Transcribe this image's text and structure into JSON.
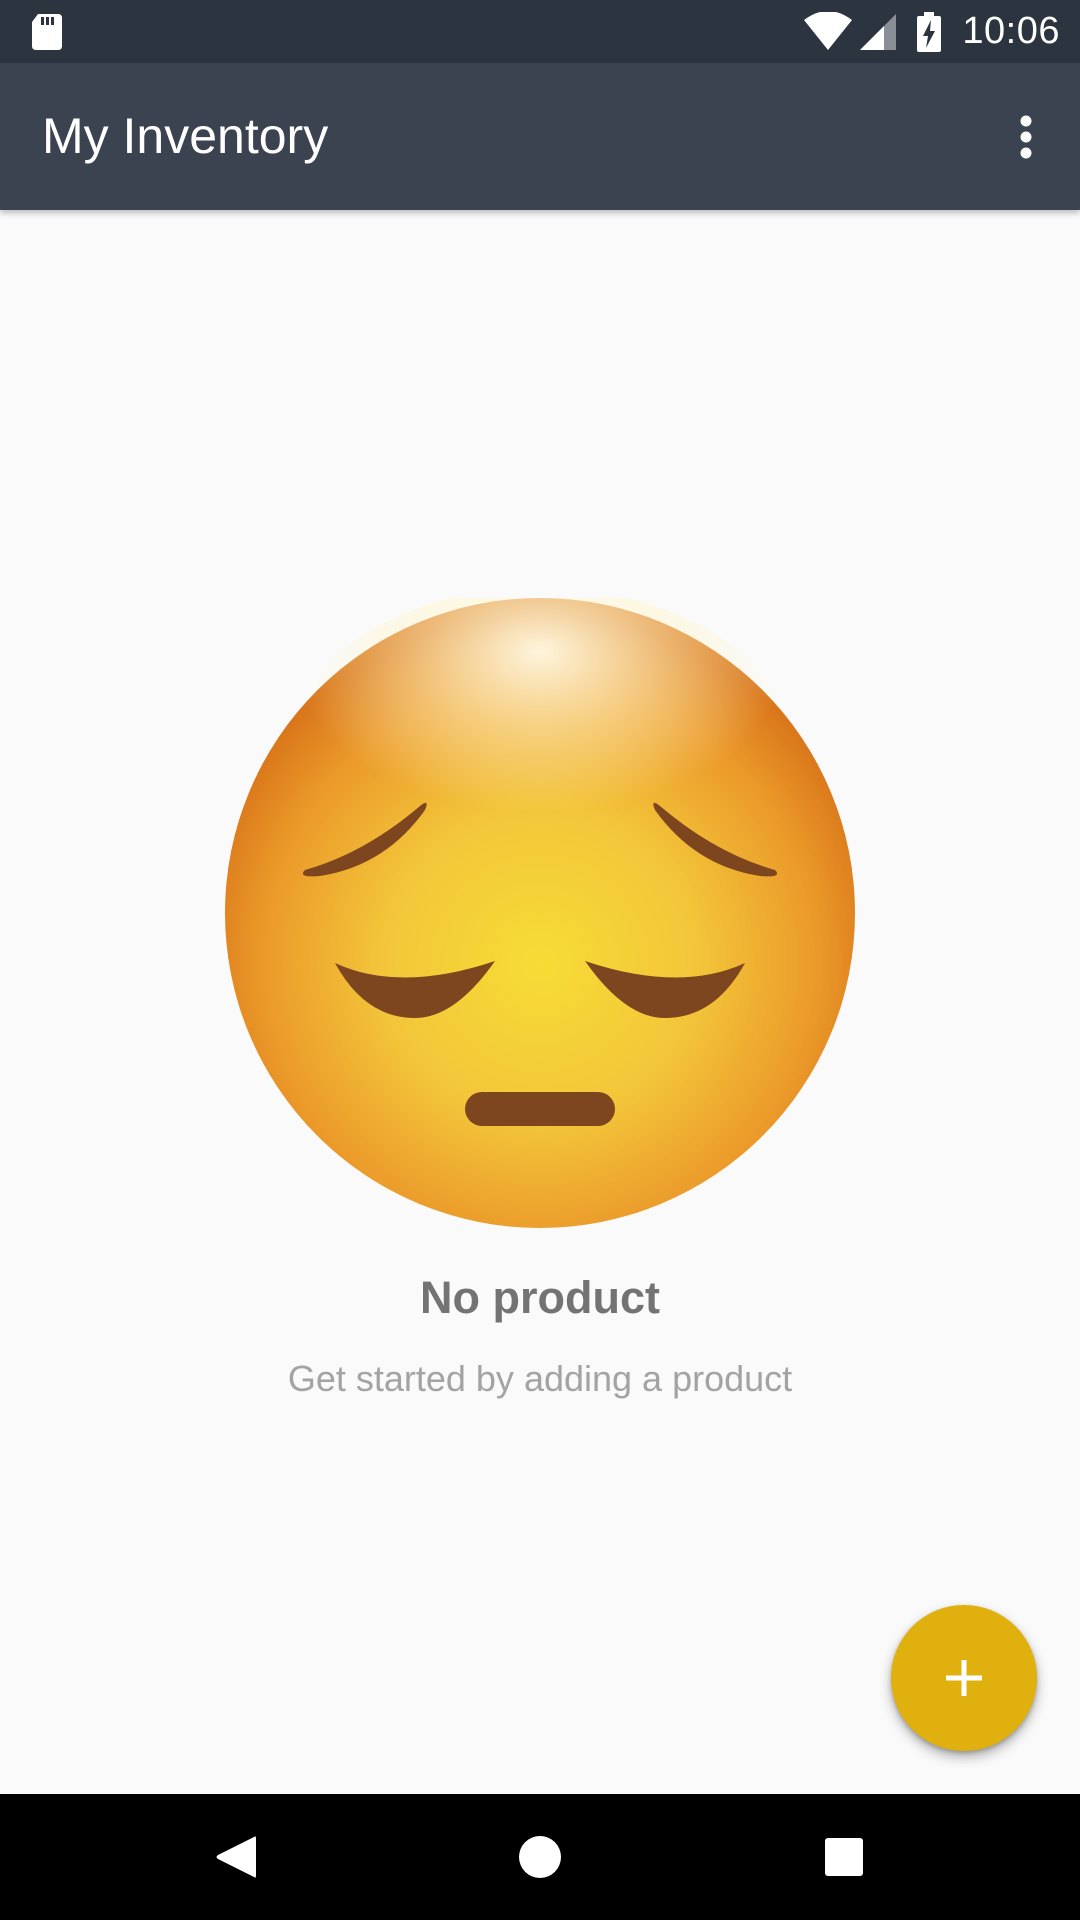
{
  "status_bar": {
    "time": "10:06",
    "icons": [
      "sd-card-icon",
      "wifi-icon",
      "cell-signal-icon",
      "battery-charging-icon"
    ]
  },
  "app_bar": {
    "title": "My Inventory",
    "menu_icon": "more-vert-icon"
  },
  "empty_state": {
    "image_icon": "pensive-face-emoji",
    "title": "No product",
    "subtitle": "Get started by adding a product"
  },
  "fab": {
    "icon": "plus-icon",
    "color": "#dfb00e"
  },
  "nav_bar": {
    "buttons": [
      "back-icon",
      "home-icon",
      "recents-icon"
    ]
  },
  "colors": {
    "status_bar": "#2c3440",
    "app_bar": "#3b4350",
    "background": "#fafafa",
    "accent": "#dfb00e"
  }
}
